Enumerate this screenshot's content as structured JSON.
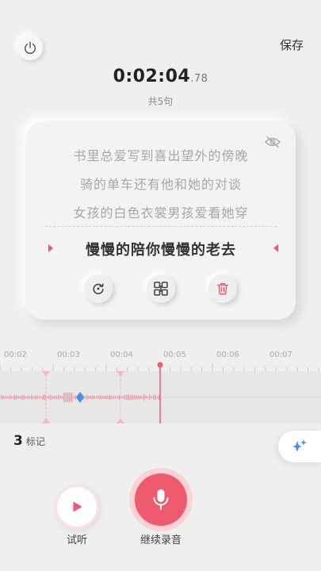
{
  "header": {
    "save_label": "保存"
  },
  "timer": {
    "main": "0:02:04",
    "fraction": ".78",
    "sentence_count": "共5句"
  },
  "lyrics": {
    "lines": [
      "书里总爱写到喜出望外的傍晚",
      "骑的单车还有他和她的对谈",
      "女孩的白色衣裳男孩爱看她穿"
    ],
    "current": "慢慢的陪你慢慢的老去"
  },
  "timeline": {
    "ticks": [
      "00:02",
      "00:03",
      "00:04",
      "00:05",
      "00:06",
      "00:07"
    ]
  },
  "marks": {
    "count": "3",
    "label": "标记"
  },
  "controls": {
    "listen_label": "试听",
    "record_label": "继续录音"
  },
  "colors": {
    "accent": "#ee5b6e",
    "accent_light": "#fbd3d7",
    "marker_blue": "#4a8fe6"
  },
  "icons": [
    "power-icon",
    "eye-off-icon",
    "redo-icon",
    "split-icon",
    "trash-icon",
    "sparkle-icon",
    "play-icon",
    "mic-icon"
  ]
}
